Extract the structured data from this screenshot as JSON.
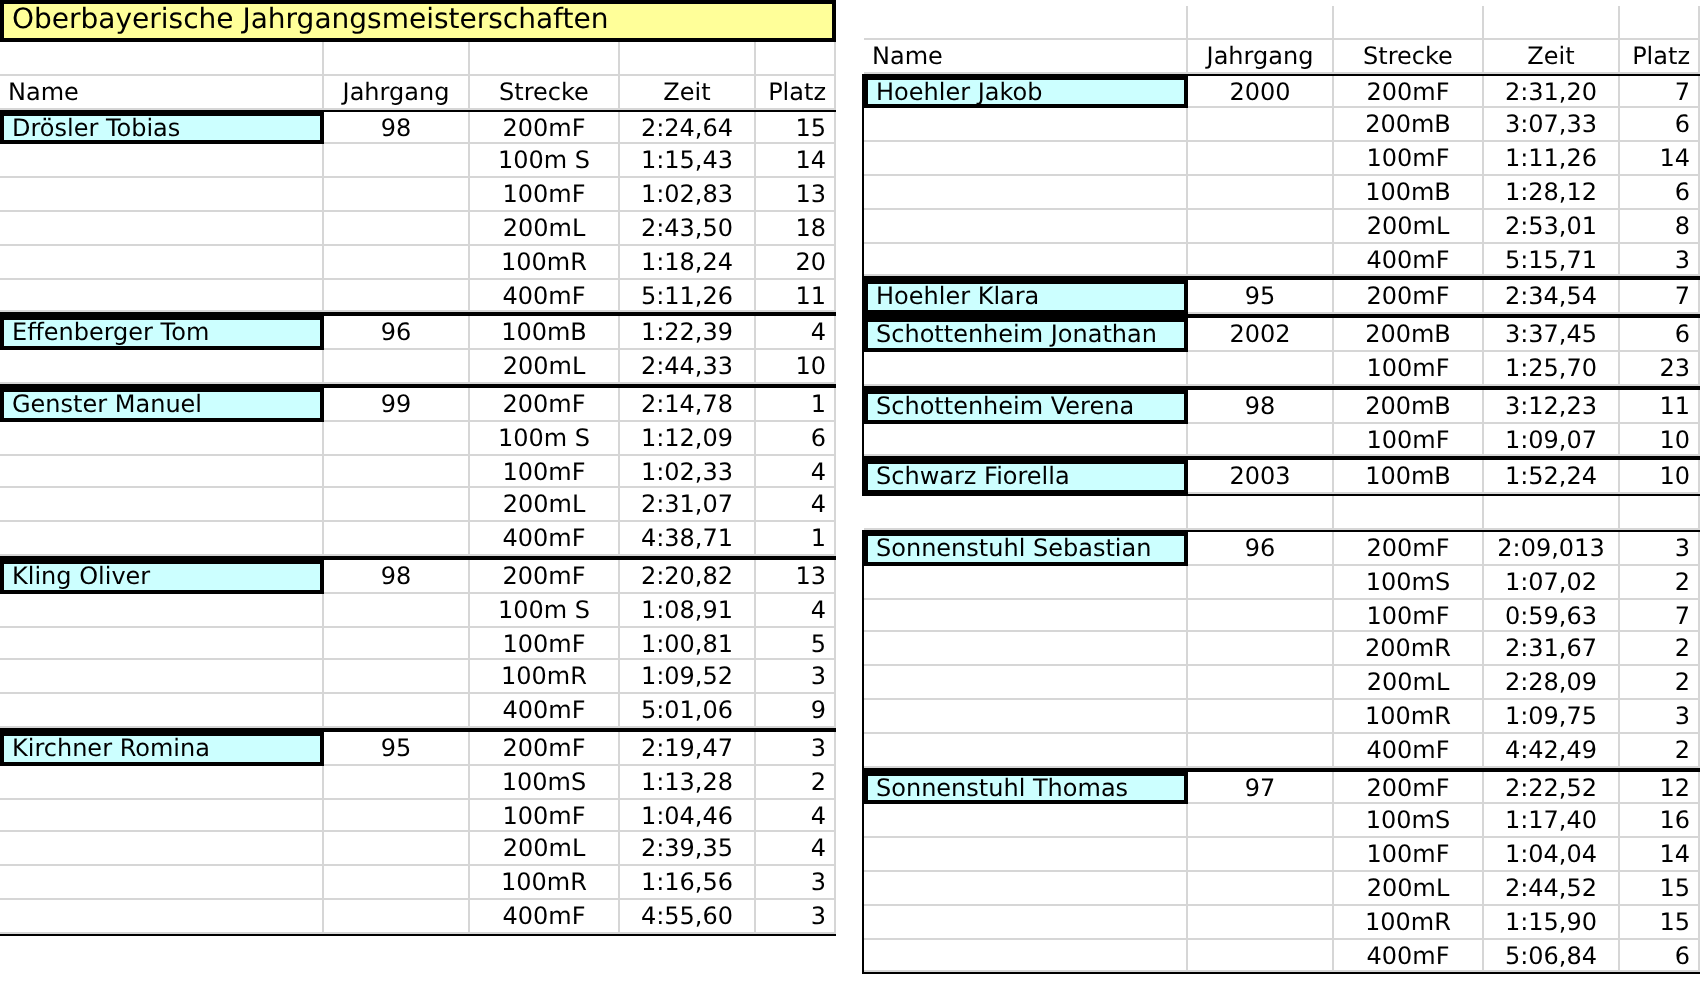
{
  "title": "Oberbayerische Jahrgangsmeisterschaften",
  "tables": [
    {
      "columns": [
        "Name",
        "Jahrgang",
        "Strecke",
        "Zeit",
        "Platz"
      ],
      "groups": [
        {
          "kind": "athlete",
          "name": "Drösler Tobias",
          "jahrgang": "98",
          "results": [
            {
              "strecke": "200mF",
              "zeit": "2:24,64",
              "platz": "15"
            },
            {
              "strecke": "100m S",
              "zeit": "1:15,43",
              "platz": "14"
            },
            {
              "strecke": "100mF",
              "zeit": "1:02,83",
              "platz": "13"
            },
            {
              "strecke": "200mL",
              "zeit": "2:43,50",
              "platz": "18"
            },
            {
              "strecke": "100mR",
              "zeit": "1:18,24",
              "platz": "20"
            },
            {
              "strecke": "400mF",
              "zeit": "5:11,26",
              "platz": "11"
            }
          ]
        },
        {
          "kind": "athlete",
          "name": "Effenberger Tom",
          "jahrgang": "96",
          "results": [
            {
              "strecke": "100mB",
              "zeit": "1:22,39",
              "platz": "4"
            },
            {
              "strecke": "200mL",
              "zeit": "2:44,33",
              "platz": "10"
            }
          ]
        },
        {
          "kind": "athlete",
          "name": "Genster Manuel",
          "jahrgang": "99",
          "results": [
            {
              "strecke": "200mF",
              "zeit": "2:14,78",
              "platz": "1"
            },
            {
              "strecke": "100m S",
              "zeit": "1:12,09",
              "platz": "6"
            },
            {
              "strecke": "100mF",
              "zeit": "1:02,33",
              "platz": "4"
            },
            {
              "strecke": "200mL",
              "zeit": "2:31,07",
              "platz": "4"
            },
            {
              "strecke": "400mF",
              "zeit": "4:38,71",
              "platz": "1"
            }
          ]
        },
        {
          "kind": "athlete",
          "name": "Kling Oliver",
          "jahrgang": "98",
          "results": [
            {
              "strecke": "200mF",
              "zeit": "2:20,82",
              "platz": "13"
            },
            {
              "strecke": "100m S",
              "zeit": "1:08,91",
              "platz": "4"
            },
            {
              "strecke": "100mF",
              "zeit": "1:00,81",
              "platz": "5"
            },
            {
              "strecke": "100mR",
              "zeit": "1:09,52",
              "platz": "3"
            },
            {
              "strecke": "400mF",
              "zeit": "5:01,06",
              "platz": "9"
            }
          ]
        },
        {
          "kind": "athlete",
          "name": "Kirchner Romina",
          "jahrgang": "95",
          "results": [
            {
              "strecke": "200mF",
              "zeit": "2:19,47",
              "platz": "3"
            },
            {
              "strecke": "100mS",
              "zeit": "1:13,28",
              "platz": "2"
            },
            {
              "strecke": "100mF",
              "zeit": "1:04,46",
              "platz": "4"
            },
            {
              "strecke": "200mL",
              "zeit": "2:39,35",
              "platz": "4"
            },
            {
              "strecke": "100mR",
              "zeit": "1:16,56",
              "platz": "3"
            },
            {
              "strecke": "400mF",
              "zeit": "4:55,60",
              "platz": "3"
            }
          ]
        }
      ]
    },
    {
      "columns": [
        "Name",
        "Jahrgang",
        "Strecke",
        "Zeit",
        "Platz"
      ],
      "groups": [
        {
          "kind": "athlete",
          "name": "Hoehler Jakob",
          "jahrgang": "2000",
          "results": [
            {
              "strecke": "200mF",
              "zeit": "2:31,20",
              "platz": "7"
            },
            {
              "strecke": "200mB",
              "zeit": "3:07,33",
              "platz": "6"
            },
            {
              "strecke": "100mF",
              "zeit": "1:11,26",
              "platz": "14"
            },
            {
              "strecke": "100mB",
              "zeit": "1:28,12",
              "platz": "6"
            },
            {
              "strecke": "200mL",
              "zeit": "2:53,01",
              "platz": "8"
            },
            {
              "strecke": "400mF",
              "zeit": "5:15,71",
              "platz": "3"
            }
          ]
        },
        {
          "kind": "athlete",
          "name": "Hoehler Klara",
          "jahrgang": "95",
          "results": [
            {
              "strecke": "200mF",
              "zeit": "2:34,54",
              "platz": "7"
            }
          ]
        },
        {
          "kind": "athlete",
          "name": "Schottenheim Jonathan",
          "jahrgang": "2002",
          "results": [
            {
              "strecke": "200mB",
              "zeit": "3:37,45",
              "platz": "6"
            },
            {
              "strecke": "100mF",
              "zeit": "1:25,70",
              "platz": "23"
            }
          ]
        },
        {
          "kind": "athlete",
          "name": "Schottenheim Verena",
          "jahrgang": "98",
          "results": [
            {
              "strecke": "200mB",
              "zeit": "3:12,23",
              "platz": "11"
            },
            {
              "strecke": "100mF",
              "zeit": "1:09,07",
              "platz": "10"
            }
          ]
        },
        {
          "kind": "athlete",
          "name": "Schwarz Fiorella",
          "jahrgang": "2003",
          "results": [
            {
              "strecke": "100mB",
              "zeit": "1:52,24",
              "platz": "10"
            }
          ]
        },
        {
          "kind": "blank"
        },
        {
          "kind": "athlete",
          "name": "Sonnenstuhl Sebastian",
          "jahrgang": "96",
          "results": [
            {
              "strecke": "200mF",
              "zeit": "2:09,013",
              "platz": "3"
            },
            {
              "strecke": "100mS",
              "zeit": "1:07,02",
              "platz": "2"
            },
            {
              "strecke": "100mF",
              "zeit": "0:59,63",
              "platz": "7"
            },
            {
              "strecke": "200mR",
              "zeit": "2:31,67",
              "platz": "2"
            },
            {
              "strecke": "200mL",
              "zeit": "2:28,09",
              "platz": "2"
            },
            {
              "strecke": "100mR",
              "zeit": "1:09,75",
              "platz": "3"
            },
            {
              "strecke": "400mF",
              "zeit": "4:42,49",
              "platz": "2"
            }
          ]
        },
        {
          "kind": "athlete",
          "name": "Sonnenstuhl Thomas",
          "jahrgang": "97",
          "results": [
            {
              "strecke": "200mF",
              "zeit": "2:22,52",
              "platz": "12"
            },
            {
              "strecke": "100mS",
              "zeit": "1:17,40",
              "platz": "16"
            },
            {
              "strecke": "100mF",
              "zeit": "1:04,04",
              "platz": "14"
            },
            {
              "strecke": "200mL",
              "zeit": "2:44,52",
              "platz": "15"
            },
            {
              "strecke": "100mR",
              "zeit": "1:15,90",
              "platz": "15"
            },
            {
              "strecke": "400mF",
              "zeit": "5:06,84",
              "platz": "6"
            }
          ]
        }
      ]
    }
  ]
}
